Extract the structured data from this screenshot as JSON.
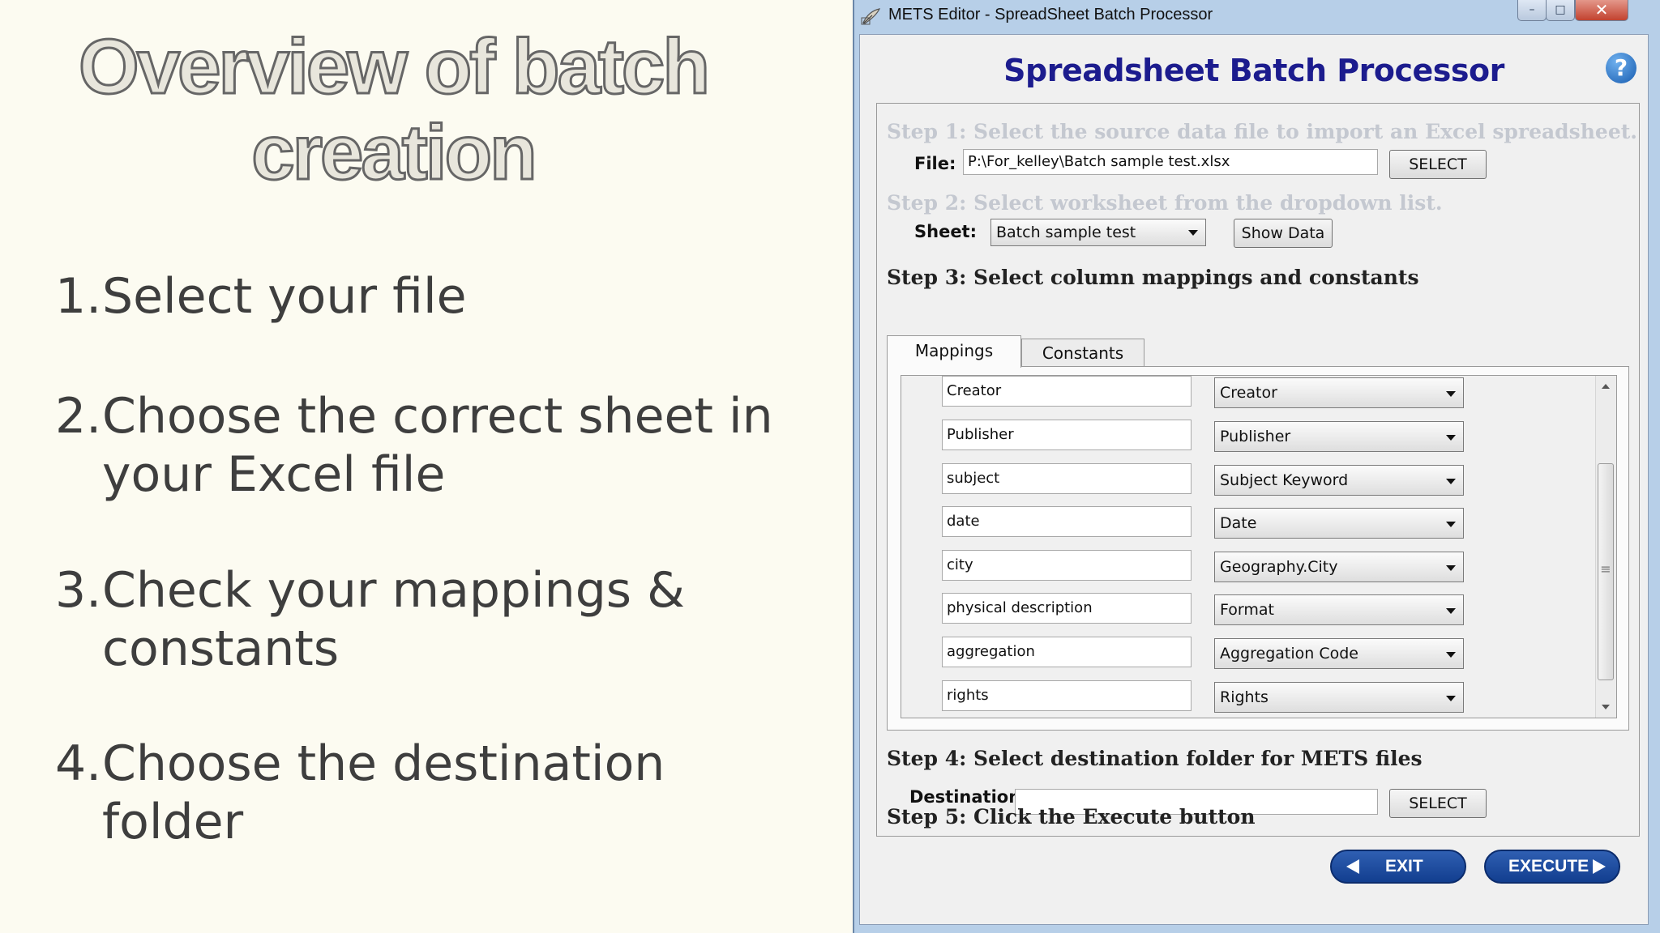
{
  "slide": {
    "title": "Overview of batch creation",
    "steps": [
      {
        "number": "1.",
        "text": "Select your file"
      },
      {
        "number": "2.",
        "text": "Choose the correct sheet in your Excel file"
      },
      {
        "number": "3.",
        "text": "Check your mappings & constants"
      },
      {
        "number": "4.",
        "text": "Choose the destination folder"
      }
    ]
  },
  "window": {
    "title": "METS Editor - SpreadSheet Batch Processor",
    "controls": {
      "minimize": "–",
      "maximize": "□",
      "close": "✕"
    }
  },
  "dialog": {
    "heading": "Spreadsheet Batch Processor",
    "help_icon": "?",
    "step1": {
      "label": "Step 1: Select the source data file to import an Excel spreadsheet.",
      "field_label": "File:",
      "file_value": "P:\\For_kelley\\Batch sample test.xlsx",
      "select_button": "SELECT"
    },
    "step2": {
      "label": "Step 2: Select worksheet from the dropdown list.",
      "field_label": "Sheet:",
      "sheet_value": "Batch sample test",
      "show_data_button": "Show Data"
    },
    "step3": {
      "label": "Step 3: Select column mappings and constants",
      "tabs": [
        "Mappings",
        "Constants"
      ],
      "active_tab": "Mappings",
      "mappings": [
        {
          "column": "Creator",
          "field": "Creator"
        },
        {
          "column": "Publisher",
          "field": "Publisher"
        },
        {
          "column": "subject",
          "field": "Subject Keyword"
        },
        {
          "column": "date",
          "field": "Date"
        },
        {
          "column": "city",
          "field": "Geography.City"
        },
        {
          "column": "physical description",
          "field": "Format"
        },
        {
          "column": "aggregation",
          "field": "Aggregation Code"
        },
        {
          "column": "rights",
          "field": "Rights"
        }
      ],
      "scroll_grip": "≡"
    },
    "step4": {
      "label": "Step 4: Select destination folder for METS files",
      "field_label": "Destination:",
      "destination_value": "",
      "select_button": "SELECT"
    },
    "step5": {
      "label": "Step 5: Click the Execute button"
    },
    "buttons": {
      "exit": "EXIT",
      "execute": "EXECUTE"
    }
  },
  "colors": {
    "slide_background": "#fcfbf1",
    "heading_blue": "#1c1c8e",
    "pill_button_blue": "#1f4fa3",
    "dimmed_step_text": "#c4c8d0",
    "window_frame": "#b7cfe8"
  },
  "icons": [
    "app-feather-icon",
    "help-question-icon",
    "dropdown-arrow-icon",
    "back-arrow-icon",
    "forward-arrow-icon",
    "scroll-up-icon",
    "scroll-down-icon"
  ]
}
